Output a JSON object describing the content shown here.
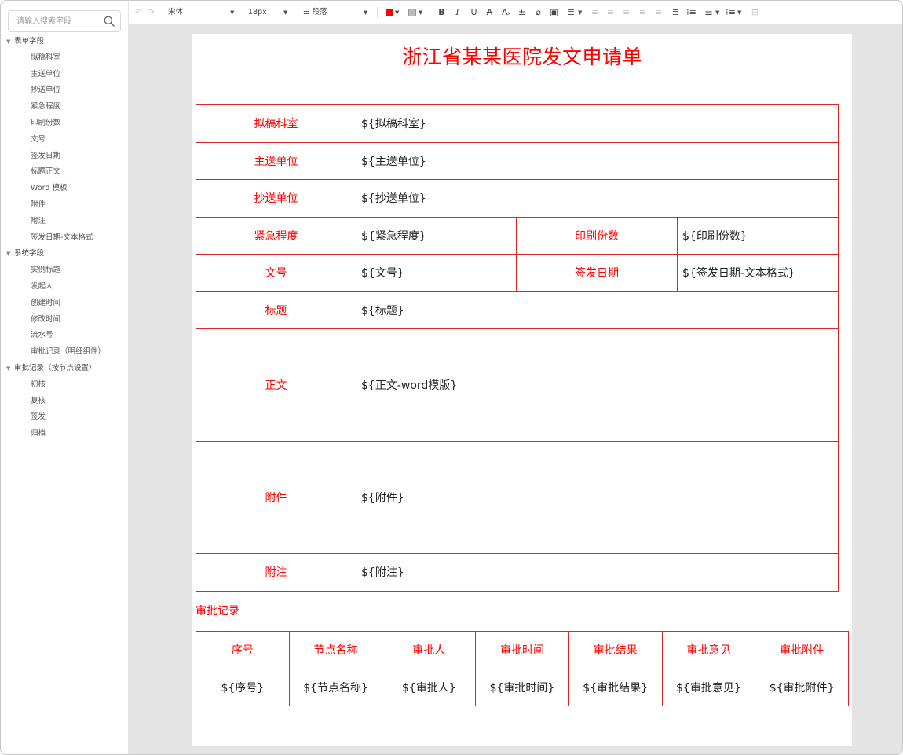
{
  "sidebar": {
    "search_placeholder": "请输入搜索字段",
    "groups": [
      {
        "label": "表单字段",
        "items": [
          "拟稿科室",
          "主送单位",
          "抄送单位",
          "紧急程度",
          "印刷份数",
          "文号",
          "签发日期",
          "标题正文",
          "Word 模板",
          "附件",
          "附注",
          "签发日期-文本格式"
        ]
      },
      {
        "label": "系统字段",
        "items": [
          "实例标题",
          "发起人",
          "创建时间",
          "修改时间",
          "流水号",
          "审批记录（明细组件）"
        ]
      },
      {
        "label": "审批记录（按节点设置）",
        "items": [
          "初核",
          "复核",
          "签发",
          "归档"
        ]
      }
    ]
  },
  "toolbar": {
    "font_family": "宋体",
    "font_size": "18px",
    "paragraph": "段落",
    "text_color": "#ff0000",
    "icons": [
      "undo-icon",
      "redo-icon",
      "bold-icon",
      "italic-icon",
      "underline-icon",
      "strikethrough-icon",
      "subscript-icon",
      "superscript-icon",
      "clear-format-icon",
      "image-icon",
      "line-height-icon",
      "align-left-icon",
      "align-center-icon",
      "align-right-icon",
      "align-justify-icon",
      "indent-icon",
      "outdent-icon",
      "bullet-list-icon",
      "numbered-list-icon",
      "table-icon"
    ]
  },
  "document": {
    "title": "浙江省某某医院发文申请单",
    "rows": {
      "r1": {
        "label": "拟稿科室",
        "value": "${拟稿科室}"
      },
      "r2": {
        "label": "主送单位",
        "value": "${主送单位}"
      },
      "r3": {
        "label": "抄送单位",
        "value": "${抄送单位}"
      },
      "r4": {
        "label": "紧急程度",
        "value": "${紧急程度}",
        "label2": "印刷份数",
        "value2": "${印刷份数}"
      },
      "r5": {
        "label": "文号",
        "value": "${文号}",
        "label2": "签发日期",
        "value2": "${签发日期-文本格式}"
      },
      "r6": {
        "label": "标题",
        "value": "${标题}"
      },
      "r7": {
        "label": "正文",
        "value": "${正文-word模版}"
      },
      "r8": {
        "label": "附件",
        "value": "${附件}"
      },
      "r9": {
        "label": "附注",
        "value": "${附注}"
      }
    },
    "approval_section_title": "审批记录",
    "approval_headers": [
      "序号",
      "节点名称",
      "审批人",
      "审批时间",
      "审批结果",
      "审批意见",
      "审批附件"
    ],
    "approval_cells": [
      "${序号}",
      "${节点名称}",
      "${审批人}",
      "${审批时间}",
      "${审批结果}",
      "${审批意见}",
      "${审批附件}"
    ]
  }
}
